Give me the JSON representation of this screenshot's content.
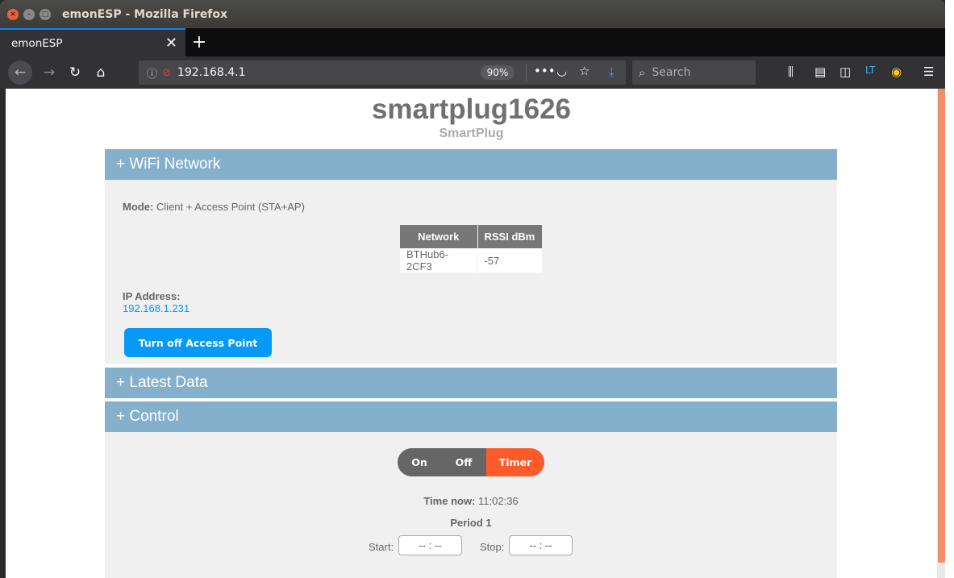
{
  "window": {
    "title": "emonESP - Mozilla Firefox"
  },
  "browser": {
    "tab_title": "emonESP",
    "url": "192.168.4.1",
    "zoom": "90%",
    "search_placeholder": "Search"
  },
  "header": {
    "title": "smartplug1626",
    "subtitle": "SmartPlug"
  },
  "wifi": {
    "heading": "+ WiFi Network",
    "mode_label": "Mode:",
    "mode_value": "Client + Access Point (STA+AP)",
    "table": {
      "headers": [
        "Network",
        "RSSI dBm"
      ],
      "rows": [
        [
          "BTHub6-2CF3",
          "-57"
        ]
      ]
    },
    "ip_label": "IP Address:",
    "ip_value": "192.168.1.231",
    "ap_button": "Turn off Access Point"
  },
  "latest": {
    "heading": "+ Latest Data"
  },
  "control": {
    "heading": "+ Control",
    "toggle": [
      "On",
      "Off",
      "Timer"
    ],
    "selected": "Timer",
    "time_label": "Time now:",
    "time_value": "11:02:36",
    "period_label": "Period 1",
    "start_label": "Start:",
    "start_value": "-- : --",
    "stop_label": "Stop:",
    "stop_value": "-- : --"
  },
  "colors": {
    "section_header": "#85b0cc",
    "button_blue": "#0699f5",
    "timer_active": "#ff5a2a",
    "scrollbar_thumb": "#ef8f6c"
  }
}
